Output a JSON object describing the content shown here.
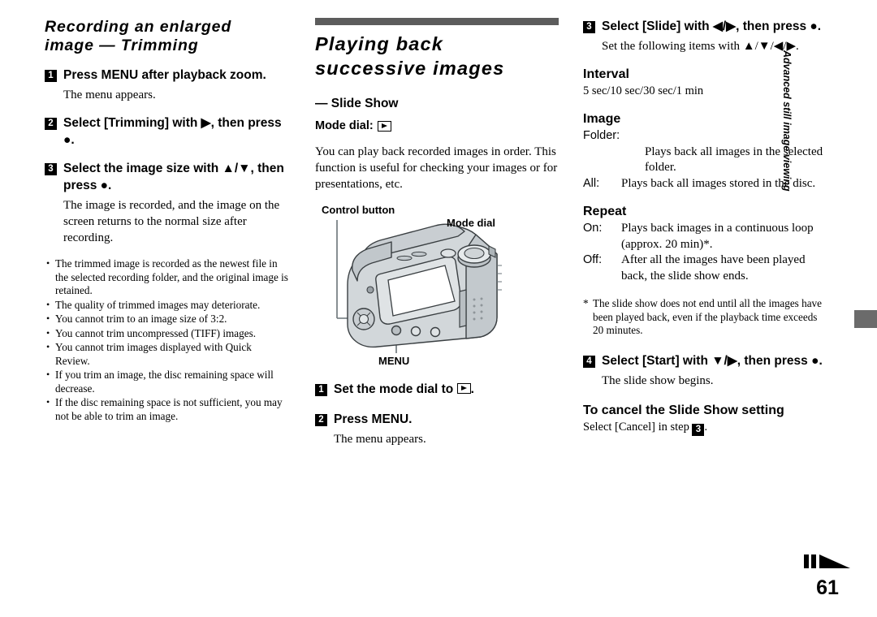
{
  "left_column": {
    "chapter_title_line1": "Recording an enlarged",
    "chapter_title_line2": "image — Trimming",
    "steps": [
      {
        "number": "1",
        "text": "Press MENU after playback zoom.",
        "note": "The menu appears."
      },
      {
        "number": "2",
        "text": "Select [Trimming] with ▶, then press ●.",
        "note": ""
      },
      {
        "number": "3",
        "text": "Select the image size with ▲/▼, then press ●.",
        "note": "The image is recorded, and the image on the screen returns to the normal size after recording."
      }
    ],
    "bullets": [
      "The trimmed image is recorded as the newest file in the selected recording folder, and the original image is retained.",
      "The quality of trimmed images may deteriorate.",
      "You cannot trim to an image size of 3:2.",
      "You cannot trim uncompressed (TIFF) images.",
      "You cannot trim images displayed with Quick Review.",
      "If you trim an image, the disc remaining space will decrease.",
      "If the disc remaining space is not sufficient, you may not be able to trim an image."
    ]
  },
  "middle_column": {
    "title_line1": "Playing back",
    "title_line2": "successive images",
    "subtitle": "— Slide Show",
    "mode_dial_label": "Mode dial:",
    "mode_dial_icon": "playback-icon",
    "intro": "You can play back recorded images in order. This function is useful for checking your images or for presentations, etc.",
    "figure": {
      "label_control_button": "Control button",
      "label_mode_dial": "Mode dial",
      "label_menu": "MENU",
      "alt": "camera-rear-illustration"
    },
    "steps": [
      {
        "number": "1",
        "text_before": "Set the mode dial to ",
        "icon": "playback-icon",
        "text_after": ".",
        "note": ""
      },
      {
        "number": "2",
        "text_before": "Press MENU.",
        "icon": "",
        "text_after": "",
        "note": "The menu appears."
      }
    ]
  },
  "right_column": {
    "step3": {
      "number": "3",
      "text": "Select [Slide] with ◀/▶, then press ●.",
      "note": "Set the following items with ▲/▼/◀/▶."
    },
    "interval": {
      "heading": "Interval",
      "value": "5 sec/10 sec/30 sec/1 min"
    },
    "image": {
      "heading": "Image",
      "folder_label": "Folder:",
      "folder_desc": "Plays back all images in the selected folder.",
      "all_label": "All:",
      "all_desc": "Plays back all images stored in the disc."
    },
    "repeat": {
      "heading": "Repeat",
      "on_label": "On:",
      "on_desc": "Plays back images in a continuous loop (approx. 20 min)*.",
      "off_label": "Off:",
      "off_desc": "After all the images have been played back, the slide show ends."
    },
    "footnote": "The slide show does not end until all the images have been played back, even if the playback time exceeds 20 minutes.",
    "step4": {
      "number": "4",
      "text": "Select [Start] with ▼/▶, then press ●.",
      "note": "The slide show begins."
    },
    "cancel": {
      "heading": "To cancel the Slide Show setting",
      "text_before": "Select [Cancel] in step ",
      "step_badge": "3",
      "text_after": "."
    }
  },
  "side_tab": {
    "label": "Advanced still image viewing",
    "block_color": "#6b6b6b"
  },
  "footer": {
    "page_number": "61",
    "mark": "chapter-mark-icon"
  },
  "colors": {
    "section_bar": "#5c5c5c",
    "badge_bg": "#000000",
    "badge_fg": "#ffffff"
  }
}
